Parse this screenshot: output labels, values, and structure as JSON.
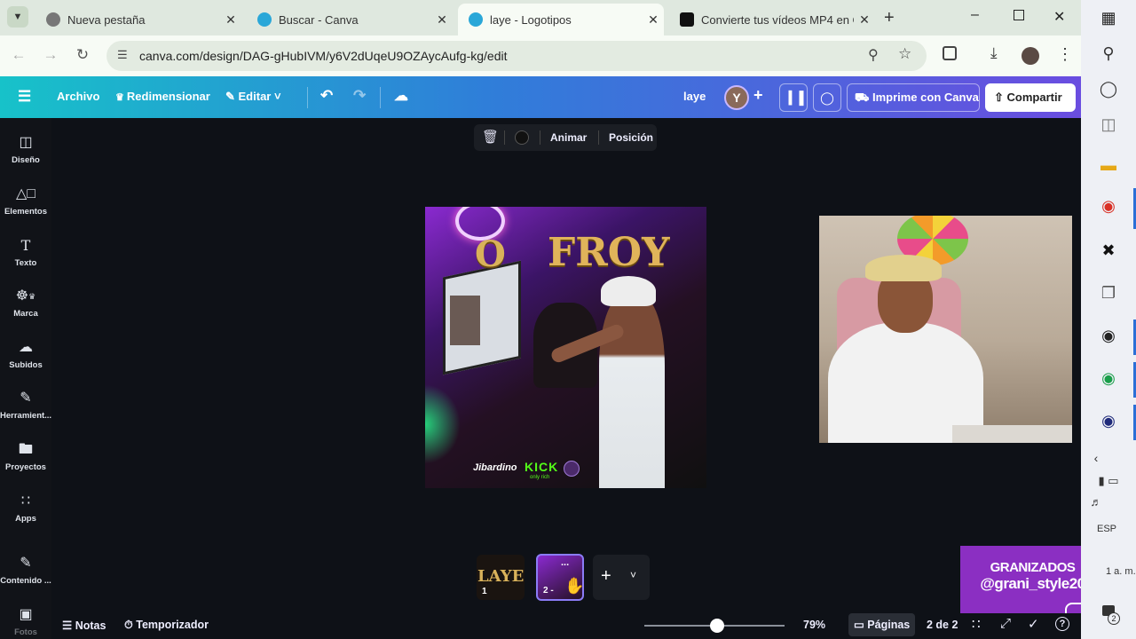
{
  "browser": {
    "tabs": [
      {
        "title": "Nueva pestaña",
        "favicon_color": "#5a5a5a",
        "active": false
      },
      {
        "title": "Buscar - Canva",
        "favicon_color": "#2aa7d8",
        "active": false
      },
      {
        "title": "laye - Logotipos",
        "favicon_color": "#2aa7d8",
        "active": true
      },
      {
        "title": "Convierte tus vídeos MP4 en Gl",
        "favicon_color": "#111111",
        "active": false
      }
    ],
    "url": "canva.com/design/DAG-gHubIVM/y6V2dUqeU9OZAycAufg-kg/edit"
  },
  "canva_toolbar": {
    "archivo": "Archivo",
    "redimensionar": "Redimensionar",
    "editar": "Editar",
    "design_name": "laye",
    "avatar_letter": "Y",
    "imprime": "Imprime con Canva",
    "compartir": "Compartir"
  },
  "sidebar": {
    "items": [
      {
        "label": "Diseño",
        "icon": "layout-icon"
      },
      {
        "label": "Elementos",
        "icon": "shapes-icon"
      },
      {
        "label": "Texto",
        "icon": "text-icon"
      },
      {
        "label": "Marca",
        "icon": "brand-icon"
      },
      {
        "label": "Subidos",
        "icon": "cloud-upload-icon"
      },
      {
        "label": "Herramient...",
        "icon": "pen-icon"
      },
      {
        "label": "Proyectos",
        "icon": "folder-icon"
      },
      {
        "label": "Apps",
        "icon": "apps-icon"
      },
      {
        "label": "Contenido ...",
        "icon": "magic-edit-icon"
      },
      {
        "label": "Fotos",
        "icon": "photo-icon"
      }
    ]
  },
  "context_toolbar": {
    "animar": "Animar",
    "posicion": "Posición"
  },
  "design": {
    "title_left": "O",
    "title_right": "FROY",
    "logo_1": "Jibardino",
    "logo_2": "KICK",
    "logo_2_sub": "only rich"
  },
  "pages": {
    "thumbs": [
      {
        "number": "1",
        "preview_text": "LAYE"
      },
      {
        "number": "2 -",
        "preview_text": "..."
      }
    ]
  },
  "status": {
    "notas": "Notas",
    "temporizador": "Temporizador",
    "zoom": "79%",
    "zoom_fraction": 0.52,
    "paginas": "Páginas",
    "page_count": "2 de 2"
  },
  "overlay": {
    "line1": "GRANIZADOS",
    "line2": "@grani_style20"
  },
  "win_taskbar": {
    "language": "ESP",
    "time_fragment": "1 a. m.",
    "notif_count": "2"
  },
  "colors": {
    "canva_gradient_start": "#17c2c9",
    "canva_gradient_end": "#6a4de0",
    "overlay_purple": "#8b2fc2",
    "page_selected_border": "#8b7cf6"
  }
}
